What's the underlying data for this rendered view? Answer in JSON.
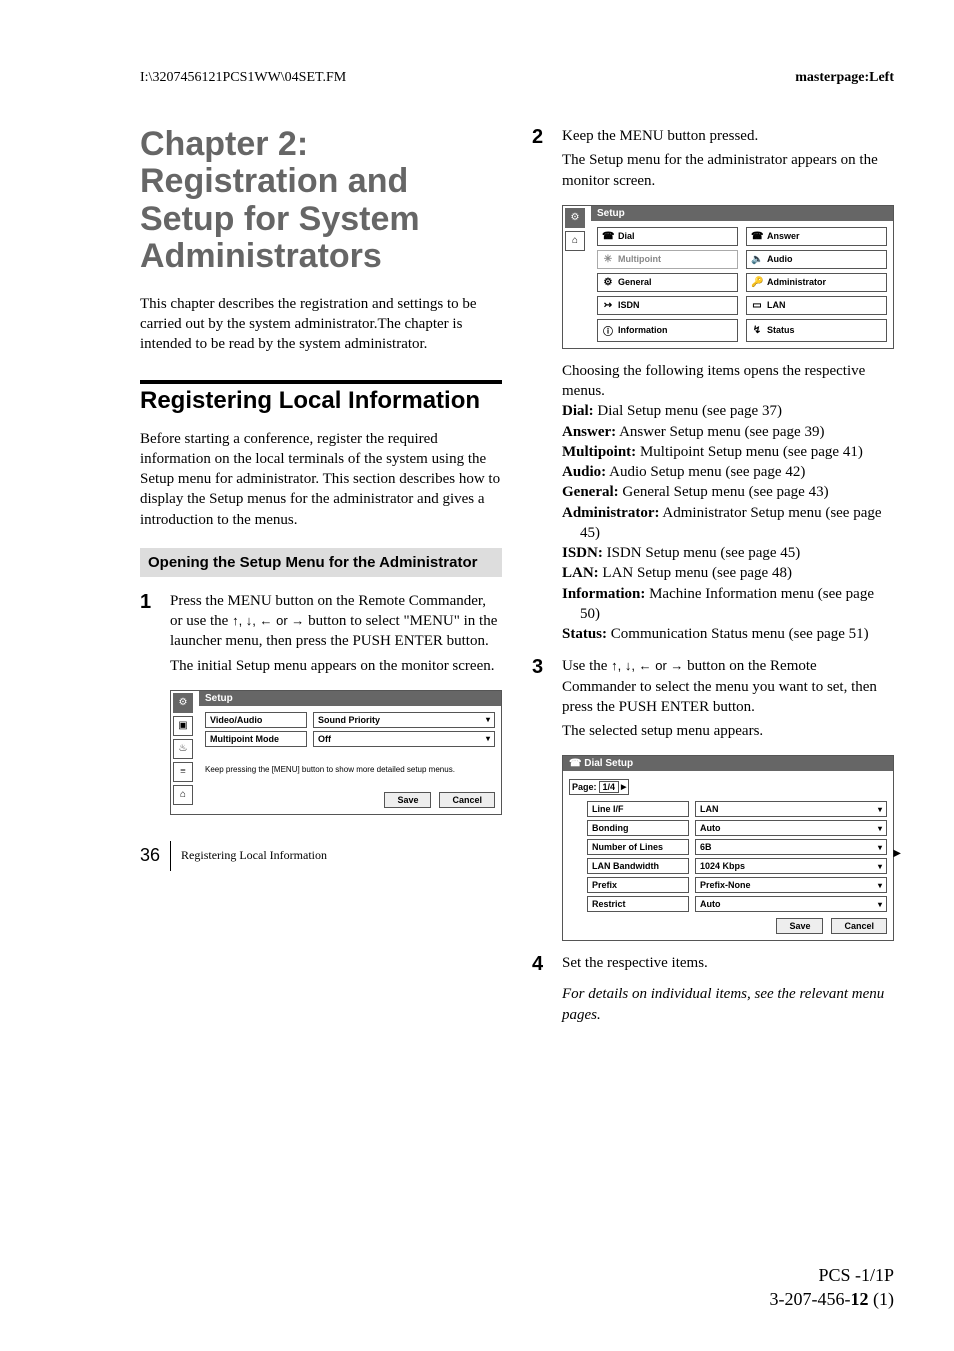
{
  "header": {
    "left": "I:\\3207456121PCS1WW\\04SET.FM",
    "right": "masterpage:Left"
  },
  "chapter_title": "Chapter 2: Registration and Setup for System Administrators",
  "intro_para": "This chapter describes the registration and settings to be carried out by the system administrator.The chapter is intended to be read by the system administrator.",
  "section_title": "Registering Local Information",
  "section_para": "Before starting a conference, register the required information on the local terminals of the system using the Setup menu for administrator. This section describes how to display the Setup menus for the administrator and gives a introduction to the menus.",
  "subsection_title": "Opening the Setup Menu for the Administrator",
  "steps": {
    "s1": {
      "num": "1",
      "text_a": "Press the  MENU button on the Remote Commander, or use the ",
      "text_b": " button to select \"MENU\" in the launcher menu, then press the PUSH ENTER button.",
      "sub": "The initial Setup menu appears on the monitor screen.",
      "arrows": "↑, ↓, ← or →"
    },
    "s2": {
      "num": "2",
      "text": "Keep the MENU button pressed.",
      "sub": "The Setup menu for the administrator appears on the monitor screen."
    },
    "s3": {
      "num": "3",
      "text_a": "Use the ",
      "text_b": " button on the Remote Commander to select the menu you want to set, then press the PUSH ENTER button.",
      "sub": "The selected setup menu appears.",
      "arrows": "↑, ↓, ← or →"
    },
    "s4": {
      "num": "4",
      "text": "Set the respective items."
    }
  },
  "screen1": {
    "title": "Setup",
    "rows": [
      {
        "label": "Video/Audio",
        "value": "Sound Priority"
      },
      {
        "label": "Multipoint Mode",
        "value": "Off"
      }
    ],
    "hint": "Keep pressing the [MENU] button to show more detailed setup menus.",
    "save": "Save",
    "cancel": "Cancel"
  },
  "screen2": {
    "title": "Setup",
    "items": [
      {
        "icon": "☎",
        "label": "Dial"
      },
      {
        "icon": "☎",
        "label": "Answer"
      },
      {
        "icon": "✳",
        "label": "Multipoint",
        "grey": true
      },
      {
        "icon": "🔈",
        "label": "Audio"
      },
      {
        "icon": "⚙",
        "label": "General"
      },
      {
        "icon": "🔑",
        "label": "Administrator"
      },
      {
        "icon": "↣",
        "label": "ISDN"
      },
      {
        "icon": "▭",
        "label": "LAN"
      },
      {
        "icon": "ⓘ",
        "label": "Information"
      },
      {
        "icon": "↯",
        "label": "Status"
      }
    ]
  },
  "def_intro": "Choosing the following items opens the respective menus.",
  "defs": [
    {
      "term": "Dial:",
      "desc": " Dial Setup menu (see page 37)"
    },
    {
      "term": "Answer:",
      "desc": " Answer Setup menu (see page 39)"
    },
    {
      "term": "Multipoint:",
      "desc": " Multipoint Setup menu (see page 41)"
    },
    {
      "term": "Audio:",
      "desc": " Audio Setup menu (see page 42)"
    },
    {
      "term": "General:",
      "desc": " General Setup menu (see page 43)"
    },
    {
      "term": "Administrator:",
      "desc": " Administrator Setup menu (see page 45)"
    },
    {
      "term": "ISDN:",
      "desc": " ISDN Setup menu (see page 45)"
    },
    {
      "term": "LAN:",
      "desc": " LAN Setup menu (see page 48)"
    },
    {
      "term": "Information:",
      "desc": " Machine Information menu (see page 50)"
    },
    {
      "term": "Status:",
      "desc": " Communication Status menu (see page 51)"
    }
  ],
  "screen3": {
    "title": "Dial Setup",
    "page_label": "Page:",
    "page_value": "1/4",
    "rows": [
      {
        "label": "Line I/F",
        "value": "LAN"
      },
      {
        "label": "Bonding",
        "value": "Auto"
      },
      {
        "label": "Number of Lines",
        "value": "6B"
      },
      {
        "label": "LAN Bandwidth",
        "value": "1024 Kbps"
      },
      {
        "label": "Prefix",
        "value": "Prefix-None"
      },
      {
        "label": "Restrict",
        "value": "Auto"
      }
    ],
    "save": "Save",
    "cancel": "Cancel"
  },
  "italic_note": "For details on individual items, see the relevant menu pages.",
  "footer": {
    "page_num": "36",
    "title": "Registering Local Information"
  },
  "bottom_right": {
    "line1": "PCS -1/1P",
    "line2_a": "3-207-456-",
    "line2_b": "12",
    "line2_c": " (1)"
  }
}
